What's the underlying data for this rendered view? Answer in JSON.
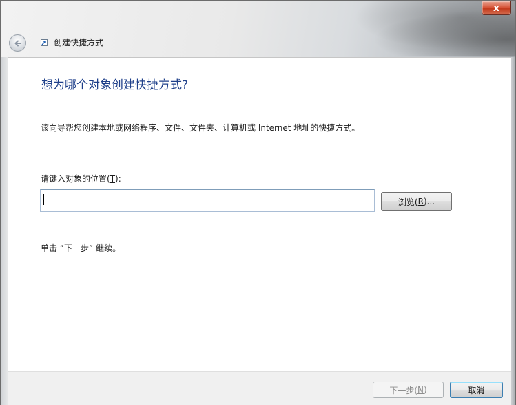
{
  "window": {
    "title": "创建快捷方式",
    "close_glyph": "x"
  },
  "content": {
    "heading": "想为哪个对象创建快捷方式?",
    "description": "该向导帮您创建本地或网络程序、文件、文件夹、计算机或 Internet 地址的快捷方式。",
    "location_label_prefix": "请键入对象的位置(",
    "location_label_key": "T",
    "location_label_suffix": "):",
    "location_value": "",
    "browse_label_prefix": "浏览(",
    "browse_label_key": "R",
    "browse_label_suffix": ")...",
    "instruction": "单击 “下一步” 继续。"
  },
  "footer": {
    "next_label_prefix": "下一步(",
    "next_label_key": "N",
    "next_label_suffix": ")",
    "cancel_label": "取消"
  },
  "icons": {
    "back": "back-arrow-icon",
    "title": "shortcut-icon",
    "close": "close-icon"
  },
  "colors": {
    "heading": "#1e3f8a",
    "close_button": "#c94125",
    "input_border": "#a9bdd5"
  }
}
